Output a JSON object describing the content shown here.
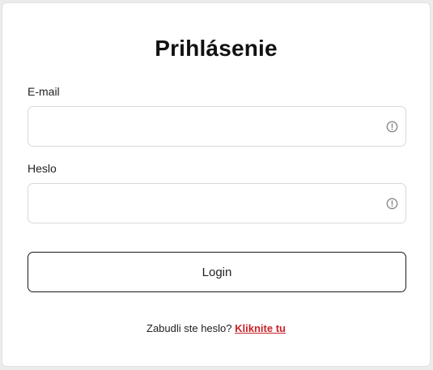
{
  "login": {
    "title": "Prihlásenie",
    "email_label": "E-mail",
    "email_value": "",
    "password_label": "Heslo",
    "password_value": "",
    "submit_label": "Login",
    "forgot_text": "Zabudli ste heslo?",
    "forgot_link": "Kliknite tu"
  },
  "colors": {
    "link": "#c8232a",
    "icon": "#8a8a8a",
    "field_border": "#d9d9d9",
    "button_border": "#1a1a1a"
  },
  "icons": {
    "field_status": "exclamation-circle-icon"
  }
}
